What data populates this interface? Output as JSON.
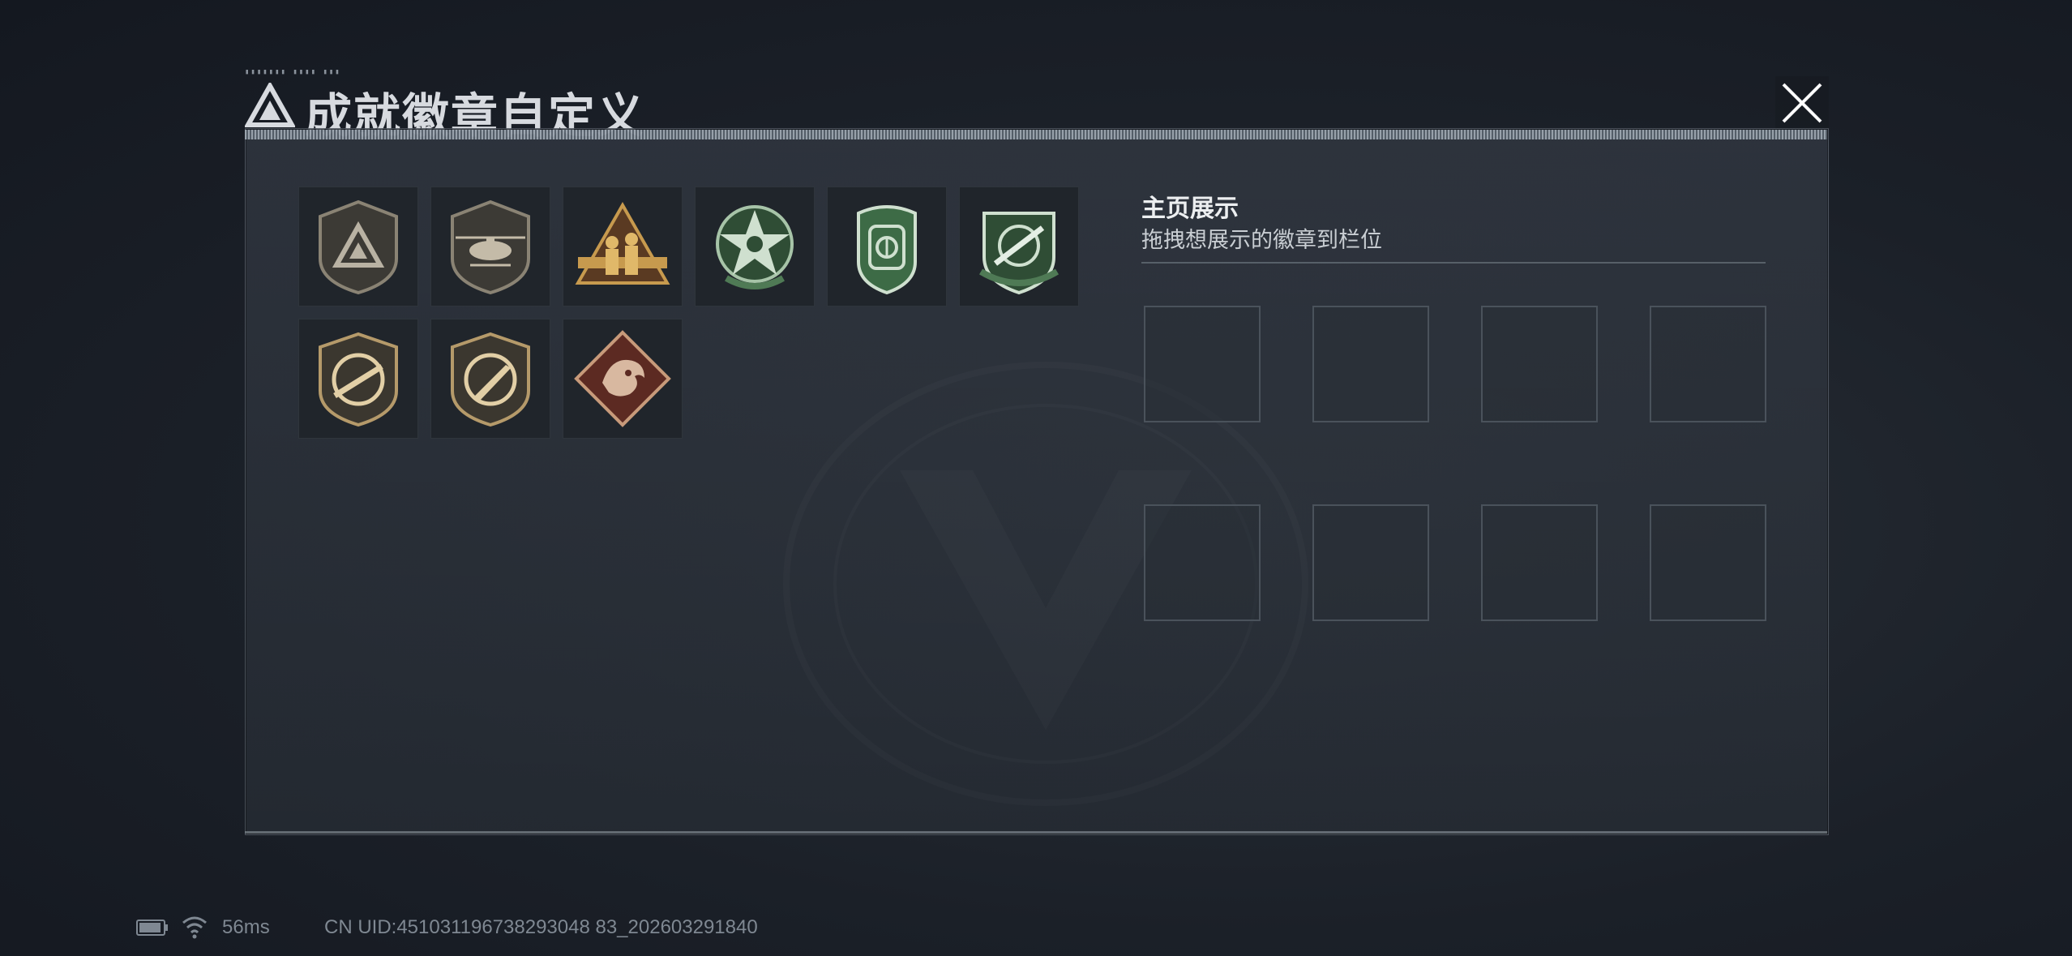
{
  "header": {
    "title": "成就徽章自定义",
    "logo_icon": "triangle-logo-icon",
    "close_icon": "close-icon"
  },
  "badges": [
    {
      "id": "badge-1",
      "icon": "triangle-shield-badge",
      "color": "#8a8374"
    },
    {
      "id": "badge-2",
      "icon": "helicopter-shield-badge",
      "color": "#8a8374"
    },
    {
      "id": "badge-3",
      "icon": "soldiers-triangle-badge",
      "color": "#c79a4e"
    },
    {
      "id": "badge-4",
      "icon": "green-star-skull-badge",
      "color": "#4f7a55"
    },
    {
      "id": "badge-5",
      "icon": "green-winged-shield-badge",
      "color": "#4f7a55"
    },
    {
      "id": "badge-6",
      "icon": "green-rifle-crosshair-badge",
      "color": "#4f7a55"
    },
    {
      "id": "badge-7",
      "icon": "rifle-circle-badge",
      "color": "#b59a6a"
    },
    {
      "id": "badge-8",
      "icon": "knife-circle-badge",
      "color": "#b59a6a"
    },
    {
      "id": "badge-9",
      "icon": "dragon-diamond-badge",
      "color": "#8c3b2e"
    }
  ],
  "showcase": {
    "title": "主页展示",
    "description": "拖拽想展示的徽章到栏位",
    "slot_count": 8
  },
  "status": {
    "ping": "56ms",
    "uid": "CN UID:451031196738293048 83_202603291840"
  }
}
